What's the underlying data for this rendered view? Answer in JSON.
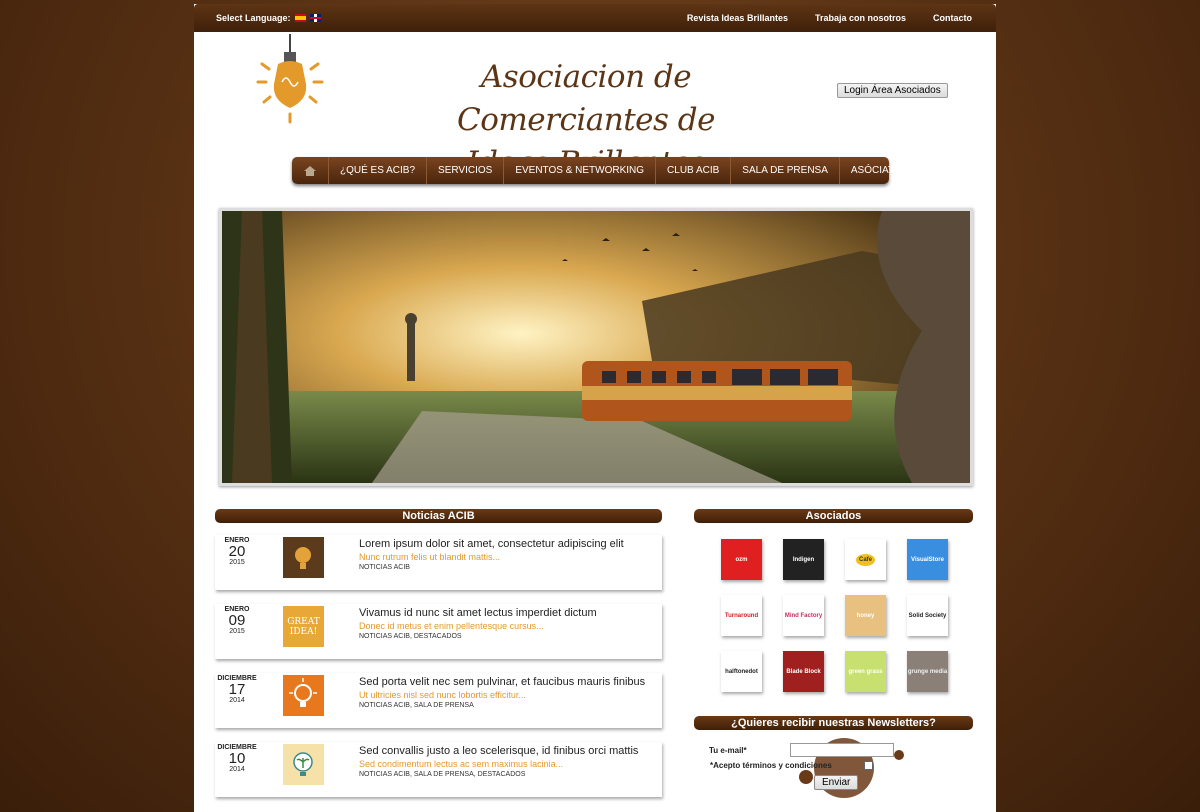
{
  "topbar": {
    "language_label": "Select Language:",
    "links": [
      "Revista Ideas Brillantes",
      "Trabaja con nosotros",
      "Contacto"
    ]
  },
  "header": {
    "brand_line1": "Asociacion de Comerciantes de",
    "brand_line2": "Ideas Brillantes",
    "login_label": "Login Área Asociados"
  },
  "nav": {
    "items": [
      "¿QUÉ ES ACIB?",
      "SERVICIOS",
      "EVENTOS & NETWORKING",
      "CLUB ACIB",
      "SALA DE PRENSA",
      "ASÓCIATE"
    ]
  },
  "news": {
    "heading": "Noticias ACIB",
    "items": [
      {
        "month": "ENERO",
        "day": "20",
        "year": "2015",
        "title": "Lorem ipsum dolor sit amet, consectetur adipiscing elit",
        "subtitle": "Nunc rutrum felis ut blandit mattis...",
        "categories": "NOTICIAS ACIB"
      },
      {
        "month": "ENERO",
        "day": "09",
        "year": "2015",
        "title": "Vivamus id nunc sit amet lectus imperdiet dictum",
        "subtitle": "Donec id metus et enim pellentesque cursus...",
        "categories": "NOTICIAS ACIB, DESTACADOS"
      },
      {
        "month": "DICIEMBRE",
        "day": "17",
        "year": "2014",
        "title": "Sed porta velit nec sem pulvinar, et faucibus mauris finibus",
        "subtitle": "Ut ultricies nisl sed nunc lobortis efficitur...",
        "categories": "NOTICIAS ACIB, SALA DE PRENSA"
      },
      {
        "month": "DICIEMBRE",
        "day": "10",
        "year": "2014",
        "title": "Sed convallis justo a leo scelerisque, id finibus orci mattis",
        "subtitle": "Sed condimentum lectus ac sem maximus lacinia...",
        "categories": "NOTICIAS ACIB, SALA DE PRENSA, DESTACADOS"
      }
    ],
    "thumb_text_2": "GREAT IDEA!"
  },
  "partners": {
    "heading": "Asociados",
    "logos": [
      "ozm",
      "Indigen",
      "Cafe",
      "VisualStore",
      "Turnaround",
      "Mind Factory",
      "honey",
      "Solid Society",
      "halftonedot",
      "Blade Block",
      "green grass",
      "grunge media"
    ]
  },
  "newsletter": {
    "heading": "¿Quieres recibir nuestras Newsletters?",
    "email_label": "Tu e-mail*",
    "terms_label": "*Acepto términos y condiciones",
    "submit_label": "Enviar"
  }
}
